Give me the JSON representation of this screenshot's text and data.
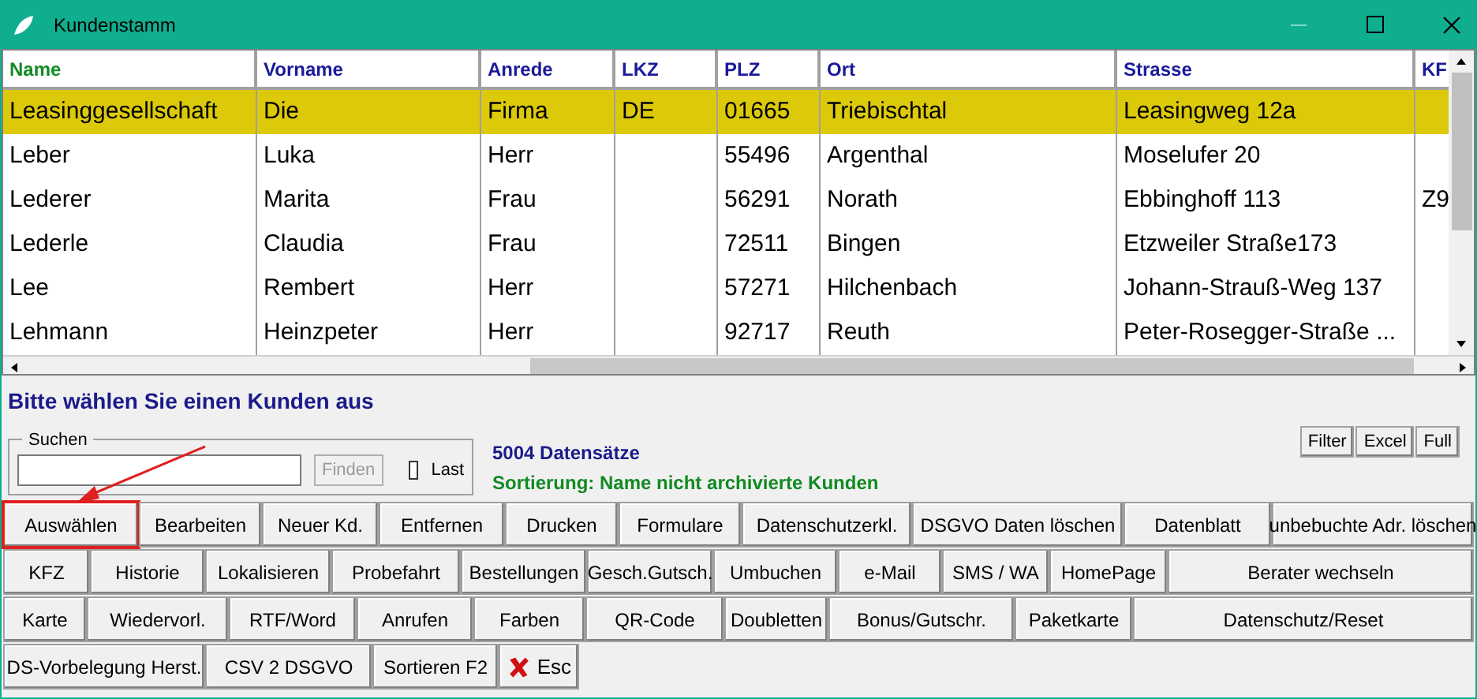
{
  "window": {
    "title": "Kundenstamm"
  },
  "table": {
    "columns": [
      {
        "label": "Name",
        "sorted": true
      },
      {
        "label": "Vorname",
        "sorted": false
      },
      {
        "label": "Anrede",
        "sorted": false
      },
      {
        "label": "LKZ",
        "sorted": false
      },
      {
        "label": "PLZ",
        "sorted": false
      },
      {
        "label": "Ort",
        "sorted": false
      },
      {
        "label": "Strasse",
        "sorted": false
      },
      {
        "label": "KF",
        "sorted": false
      }
    ],
    "rows": [
      {
        "selected": true,
        "cells": [
          "Leasinggesellschaft",
          "Die",
          "Firma",
          "DE",
          "01665",
          "Triebischtal",
          "Leasingweg 12a",
          ""
        ]
      },
      {
        "selected": false,
        "cells": [
          "Leber",
          "Luka",
          "Herr",
          "",
          "55496",
          "Argenthal",
          "Moselufer 20",
          ""
        ]
      },
      {
        "selected": false,
        "cells": [
          "Lederer",
          "Marita",
          "Frau",
          "",
          "56291",
          "Norath",
          "Ebbinghoff 113",
          "Z9"
        ]
      },
      {
        "selected": false,
        "cells": [
          "Lederle",
          "Claudia",
          "Frau",
          "",
          "72511",
          "Bingen",
          "Etzweiler Straße173",
          ""
        ]
      },
      {
        "selected": false,
        "cells": [
          "Lee",
          "Rembert",
          "Herr",
          "",
          "57271",
          "Hilchenbach",
          "Johann-Strauß-Weg 137",
          ""
        ]
      },
      {
        "selected": false,
        "cells": [
          "Lehmann",
          "Heinzpeter",
          "Herr",
          "",
          "92717",
          "Reuth",
          "Peter-Rosegger-Straße ...",
          ""
        ]
      }
    ]
  },
  "prompt": "Bitte wählen Sie einen Kunden aus",
  "search": {
    "label": "Suchen",
    "button": "Finden",
    "last_label": "Last",
    "last_checked": false
  },
  "record_count": "5004 Datensätze",
  "sorting": "Sortierung: Name nicht archivierte Kunden",
  "tools": [
    "Filter",
    "Excel",
    "Full"
  ],
  "button_rows": [
    [
      {
        "label": "Auswählen",
        "highlighted": true
      },
      {
        "label": "Bearbeiten"
      },
      {
        "label": "Neuer Kd."
      },
      {
        "label": "Entfernen"
      },
      {
        "label": "Drucken"
      },
      {
        "label": "Formulare"
      },
      {
        "label": "Datenschutzerkl."
      },
      {
        "label": "DSGVO Daten löschen"
      },
      {
        "label": "Datenblatt"
      },
      {
        "label": "unbebuchte Adr. löschen"
      }
    ],
    [
      {
        "label": "KFZ"
      },
      {
        "label": "Historie"
      },
      {
        "label": "Lokalisieren"
      },
      {
        "label": "Probefahrt"
      },
      {
        "label": "Bestellungen"
      },
      {
        "label": "Gesch.Gutsch."
      },
      {
        "label": "Umbuchen"
      },
      {
        "label": "e-Mail"
      },
      {
        "label": "SMS / WA"
      },
      {
        "label": "HomePage"
      },
      {
        "label": "Berater wechseln"
      }
    ],
    [
      {
        "label": "Karte"
      },
      {
        "label": "Wiedervorl."
      },
      {
        "label": "RTF/Word"
      },
      {
        "label": "Anrufen"
      },
      {
        "label": "Farben"
      },
      {
        "label": "QR-Code"
      },
      {
        "label": "Doubletten"
      },
      {
        "label": "Bonus/Gutschr."
      },
      {
        "label": "Paketkarte"
      },
      {
        "label": "Datenschutz/Reset"
      }
    ],
    [
      {
        "label": "DS-Vorbelegung Herst."
      },
      {
        "label": "CSV 2 DSGVO"
      },
      {
        "label": "Sortieren F2"
      },
      {
        "label": "Esc",
        "kind": "close"
      }
    ]
  ]
}
